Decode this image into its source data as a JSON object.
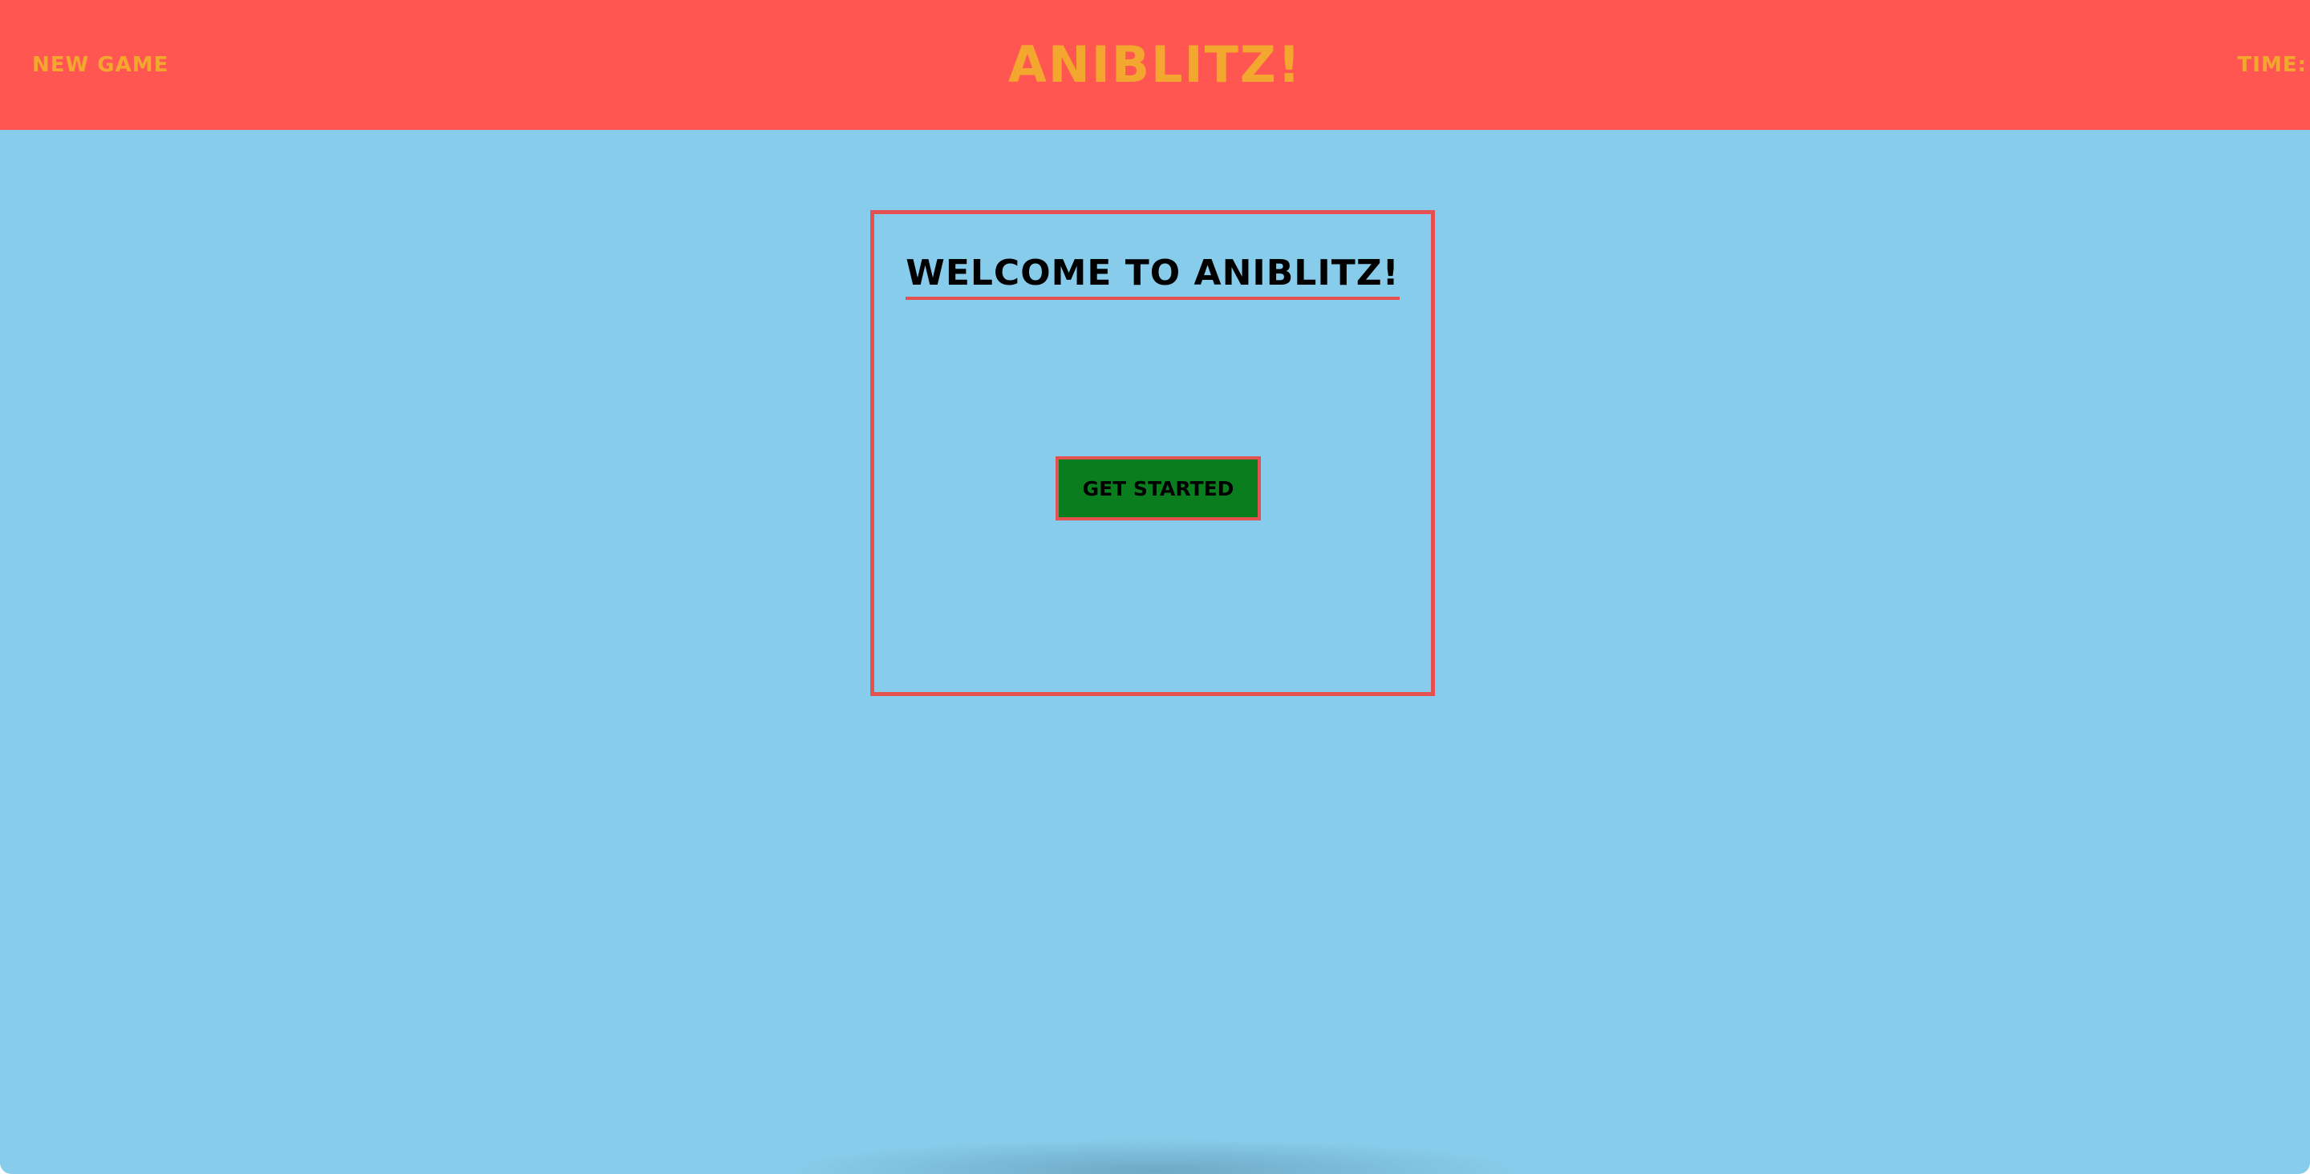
{
  "colors": {
    "header_bg": "#ff5651",
    "header_text": "#f4a72f",
    "page_bg": "#87ccea",
    "box_border": "#e55050",
    "button_bg": "#0a7d1e"
  },
  "header": {
    "new_game_label": "NEW GAME",
    "title": "ANIBLITZ!",
    "time_label": "TIME:"
  },
  "welcome": {
    "heading": "WELCOME TO ANIBLITZ!",
    "button_label": "GET STARTED"
  }
}
